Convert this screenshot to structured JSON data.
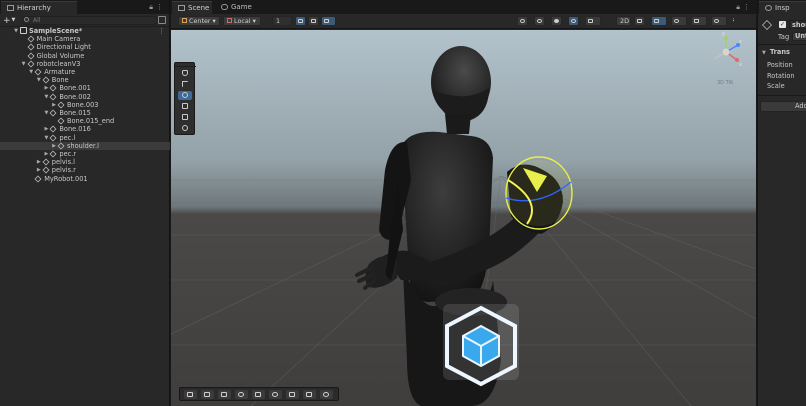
{
  "hierarchy": {
    "tab_label": "Hierarchy",
    "add_label": "+",
    "search_placeholder": "All",
    "rows": [
      {
        "label": "SampleScene*",
        "depth": 0,
        "expanded": true,
        "kind": "scene",
        "bold": true
      },
      {
        "label": "Main Camera",
        "depth": 1,
        "expanded": null,
        "kind": "object"
      },
      {
        "label": "Directional Light",
        "depth": 1,
        "expanded": null,
        "kind": "object"
      },
      {
        "label": "Global Volume",
        "depth": 1,
        "expanded": null,
        "kind": "object"
      },
      {
        "label": "robotcleanV3",
        "depth": 1,
        "expanded": true,
        "kind": "object"
      },
      {
        "label": "Armature",
        "depth": 2,
        "expanded": true,
        "kind": "object"
      },
      {
        "label": "Bone",
        "depth": 3,
        "expanded": true,
        "kind": "object"
      },
      {
        "label": "Bone.001",
        "depth": 4,
        "expanded": false,
        "kind": "object"
      },
      {
        "label": "Bone.002",
        "depth": 4,
        "expanded": true,
        "kind": "object"
      },
      {
        "label": "Bone.003",
        "depth": 5,
        "expanded": false,
        "kind": "object"
      },
      {
        "label": "Bone.015",
        "depth": 4,
        "expanded": true,
        "kind": "object"
      },
      {
        "label": "Bone.015_end",
        "depth": 5,
        "expanded": null,
        "kind": "object"
      },
      {
        "label": "Bone.016",
        "depth": 4,
        "expanded": false,
        "kind": "object"
      },
      {
        "label": "pec.l",
        "depth": 4,
        "expanded": true,
        "kind": "object"
      },
      {
        "label": "shoulder.l",
        "depth": 5,
        "expanded": false,
        "kind": "object",
        "selected": true
      },
      {
        "label": "pec.r",
        "depth": 4,
        "expanded": false,
        "kind": "object"
      },
      {
        "label": "pelvis.l",
        "depth": 3,
        "expanded": false,
        "kind": "object"
      },
      {
        "label": "pelvis.r",
        "depth": 3,
        "expanded": false,
        "kind": "object"
      },
      {
        "label": "MyRobot.001",
        "depth": 2,
        "expanded": null,
        "kind": "object"
      }
    ]
  },
  "scene": {
    "tabs": [
      {
        "label": "Scene",
        "active": true,
        "icon": "grid-icon"
      },
      {
        "label": "Game",
        "active": false,
        "icon": "gamepad-icon"
      }
    ],
    "toolbar": {
      "pivot_label": "Center",
      "space_label": "Local",
      "snap_value": "1",
      "mode_2d_label": "2D"
    },
    "gizmo": {
      "axis_y": "y",
      "axis_z": "z",
      "axis_x": "x",
      "projection_label": "3D Tilt"
    }
  },
  "inspector": {
    "tab_label": "Insp",
    "object_name": "shou",
    "tag_label": "Tag",
    "tag_value": "Unta",
    "component_label": "Trans",
    "fields": [
      "Position",
      "Rotation",
      "Scale"
    ],
    "add_button_label": "Add"
  },
  "colors": {
    "selection": "#3b3b3b",
    "accent_blue": "#3d6a99",
    "rotate_ring": "#e8ef4a",
    "panel": "#282828"
  }
}
